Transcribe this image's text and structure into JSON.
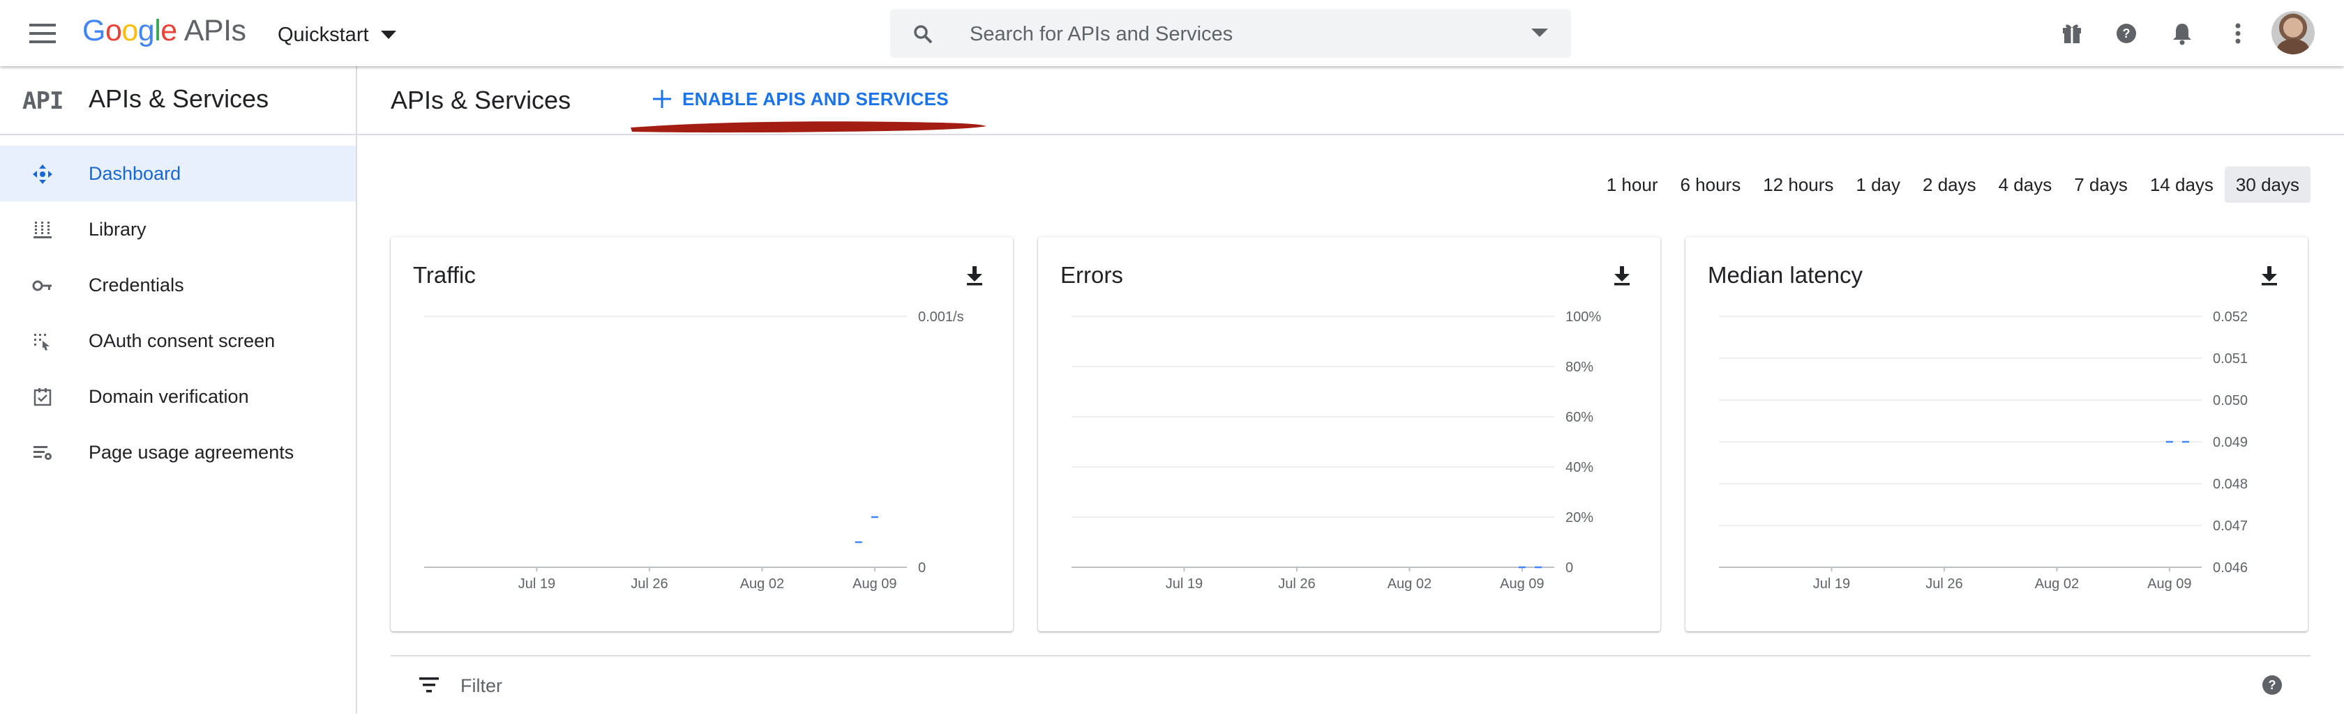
{
  "header": {
    "logo_letters": [
      {
        "ch": "G",
        "color": "#4285F4"
      },
      {
        "ch": "o",
        "color": "#EA4335"
      },
      {
        "ch": "o",
        "color": "#FBBC05"
      },
      {
        "ch": "g",
        "color": "#4285F4"
      },
      {
        "ch": "l",
        "color": "#34A853"
      },
      {
        "ch": "e",
        "color": "#EA4335"
      }
    ],
    "logo_suffix": "APIs",
    "project": "Quickstart",
    "search_placeholder": "Search for APIs and Services",
    "icons": [
      "gift-icon",
      "help-icon",
      "notifications-icon",
      "more-vert-icon"
    ]
  },
  "sidebar": {
    "logo_text": "API",
    "title": "APIs & Services",
    "items": [
      {
        "label": "Dashboard",
        "icon": "dashboard-icon",
        "active": true
      },
      {
        "label": "Library",
        "icon": "library-icon",
        "active": false
      },
      {
        "label": "Credentials",
        "icon": "key-icon",
        "active": false
      },
      {
        "label": "OAuth consent screen",
        "icon": "consent-icon",
        "active": false
      },
      {
        "label": "Domain verification",
        "icon": "verified-checkbox-icon",
        "active": false
      },
      {
        "label": "Page usage agreements",
        "icon": "settings-list-icon",
        "active": false
      }
    ]
  },
  "main": {
    "title": "APIs & Services",
    "enable_label": "ENABLE APIS AND SERVICES",
    "annotation_color": "#a31d12",
    "accent": "#1a73e8"
  },
  "time_ranges": {
    "options": [
      "1 hour",
      "6 hours",
      "12 hours",
      "1 day",
      "2 days",
      "4 days",
      "7 days",
      "14 days",
      "30 days"
    ],
    "selected": "30 days"
  },
  "filter": {
    "placeholder": "Filter"
  },
  "chart_data": [
    {
      "type": "line",
      "title": "Traffic",
      "xlabel": "",
      "ylabel": "",
      "x_ticks": [
        "Jul 19",
        "Jul 26",
        "Aug 02",
        "Aug 09"
      ],
      "y_ticks": [
        "0.001/s",
        "0"
      ],
      "ylim": [
        0,
        0.001
      ],
      "series": [
        {
          "values": [
            {
              "x": "Aug 08",
              "y": 0.0001
            },
            {
              "x": "Aug 09",
              "y": 0.0002
            }
          ]
        }
      ]
    },
    {
      "type": "line",
      "title": "Errors",
      "xlabel": "",
      "ylabel": "",
      "x_ticks": [
        "Jul 19",
        "Jul 26",
        "Aug 02",
        "Aug 09"
      ],
      "y_ticks": [
        "100%",
        "80%",
        "60%",
        "40%",
        "20%",
        "0"
      ],
      "ylim": [
        0,
        100
      ],
      "series": [
        {
          "values": [
            {
              "x": "Aug 09",
              "y": 0
            },
            {
              "x": "Aug 10",
              "y": 0
            }
          ]
        }
      ]
    },
    {
      "type": "line",
      "title": "Median latency",
      "xlabel": "",
      "ylabel": "",
      "x_ticks": [
        "Jul 19",
        "Jul 26",
        "Aug 02",
        "Aug 09"
      ],
      "y_ticks": [
        "0.052",
        "0.051",
        "0.050",
        "0.049",
        "0.048",
        "0.047",
        "0.046"
      ],
      "ylim": [
        0.046,
        0.052
      ],
      "series": [
        {
          "values": [
            {
              "x": "Aug 09",
              "y": 0.049
            },
            {
              "x": "Aug 10",
              "y": 0.049
            }
          ]
        }
      ]
    }
  ]
}
